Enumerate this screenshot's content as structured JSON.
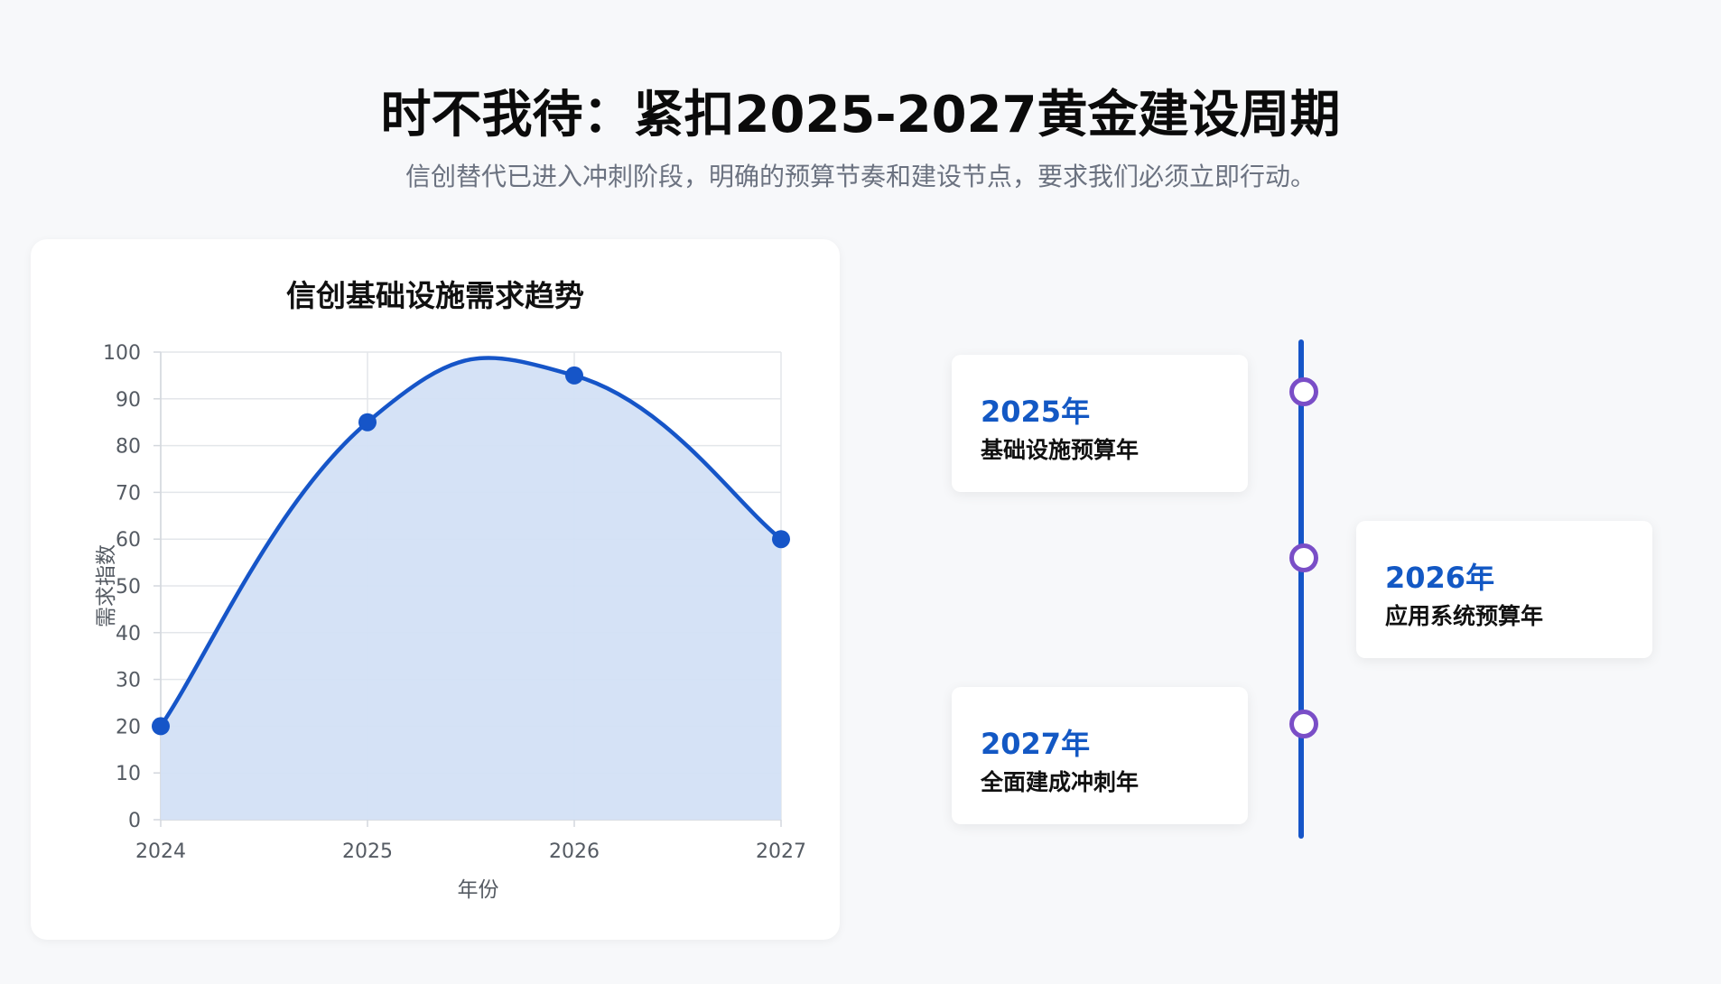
{
  "header": {
    "title": "时不我待：紧扣2025-2027黄金建设周期",
    "subtitle": "信创替代已进入冲刺阶段，明确的预算节奏和建设节点，要求我们必须立即行动。"
  },
  "chart_data": {
    "type": "area",
    "title": "信创基础设施需求趋势",
    "xlabel": "年份",
    "ylabel": "需求指数",
    "categories": [
      "2024",
      "2025",
      "2026",
      "2027"
    ],
    "series": [
      {
        "values": [
          20,
          85,
          95,
          60
        ]
      }
    ],
    "ylim": [
      0,
      100
    ],
    "yticks": [
      0,
      10,
      20,
      30,
      40,
      50,
      60,
      70,
      80,
      90,
      100
    ],
    "grid": true,
    "line_color": "#1655c8",
    "fill_color": "#d3e0f6"
  },
  "timeline": {
    "line_color": "#1655c8",
    "dot_color": "#7a4ec7",
    "items": [
      {
        "year": "2025年",
        "label": "基础设施预算年"
      },
      {
        "year": "2026年",
        "label": "应用系统预算年"
      },
      {
        "year": "2027年",
        "label": "全面建成冲刺年"
      }
    ]
  }
}
